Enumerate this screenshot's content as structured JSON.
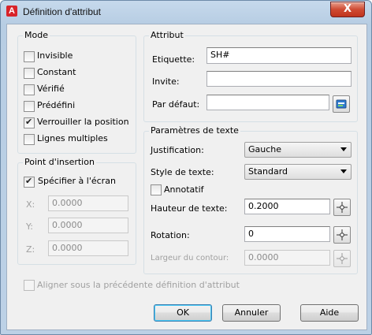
{
  "window": {
    "title": "Définition d'attribut",
    "close_label": "X",
    "app_icon_letter": "A"
  },
  "mode": {
    "title": "Mode",
    "options": [
      {
        "label": "Invisible",
        "checked": false
      },
      {
        "label": "Constant",
        "checked": false
      },
      {
        "label": "Vérifié",
        "checked": false
      },
      {
        "label": "Prédéfini",
        "checked": false
      },
      {
        "label": "Verrouiller la position",
        "checked": true
      },
      {
        "label": "Lignes multiples",
        "checked": false
      }
    ]
  },
  "insertion": {
    "title": "Point d'insertion",
    "specify_label": "Spécifier à l'écran",
    "specify_checked": true,
    "x_label": "X:",
    "x_value": "0.0000",
    "y_label": "Y:",
    "y_value": "0.0000",
    "z_label": "Z:",
    "z_value": "0.0000"
  },
  "attribut": {
    "title": "Attribut",
    "etiquette_label": "Etiquette:",
    "etiquette_value": "SH#",
    "invite_label": "Invite:",
    "invite_value": "",
    "defaut_label": "Par défaut:",
    "defaut_value": ""
  },
  "text_params": {
    "title": "Paramètres de texte",
    "justification_label": "Justification:",
    "justification_value": "Gauche",
    "style_label": "Style de texte:",
    "style_value": "Standard",
    "annotatif_label": "Annotatif",
    "annotatif_checked": false,
    "hauteur_label": "Hauteur de texte:",
    "hauteur_value": "0.2000",
    "rotation_label": "Rotation:",
    "rotation_value": "0",
    "largeur_label": "Largeur du contour:",
    "largeur_value": "0.0000"
  },
  "align_label": "Aligner sous la précédente définition d'attribut",
  "buttons": {
    "ok": "OK",
    "cancel": "Annuler",
    "help": "Aide"
  }
}
